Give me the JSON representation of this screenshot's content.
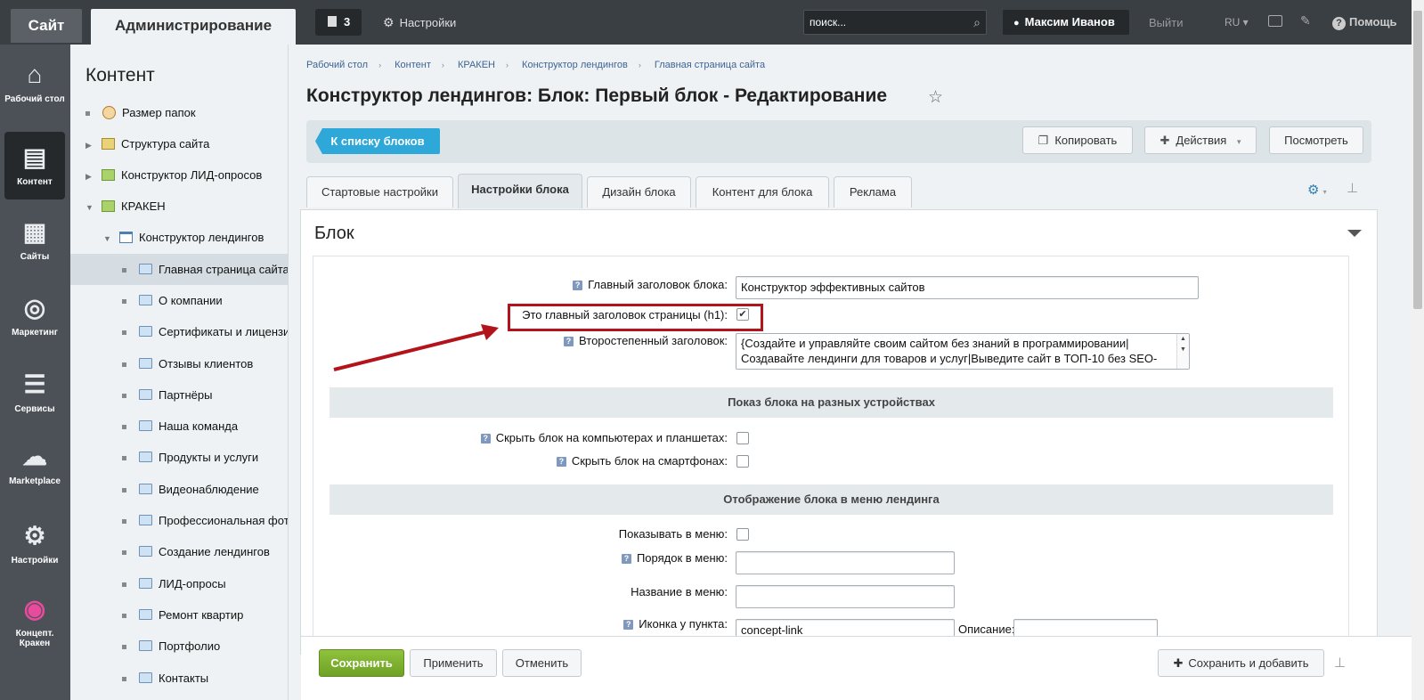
{
  "topbar": {
    "site_tab": "Сайт",
    "admin_tab": "Администрирование",
    "notifications_count": "3",
    "settings_label": "Настройки",
    "search_placeholder": "поиск...",
    "user_name": "Максим Иванов",
    "exit_label": "Выйти",
    "lang_label": "RU",
    "help_label": "Помощь"
  },
  "leftnav": {
    "items": [
      {
        "label": "Рабочий стол",
        "icon": "home-icon"
      },
      {
        "label": "Контент",
        "icon": "document-icon"
      },
      {
        "label": "Сайты",
        "icon": "calendar-icon"
      },
      {
        "label": "Маркетинг",
        "icon": "target-icon"
      },
      {
        "label": "Сервисы",
        "icon": "layers-icon"
      },
      {
        "label": "Marketplace",
        "icon": "cloud-download-icon"
      },
      {
        "label": "Настройки",
        "icon": "gear-icon"
      },
      {
        "label": "Концепт. Кракен",
        "icon": "kraken-logo-icon"
      }
    ]
  },
  "tree": {
    "title": "Контент",
    "items": [
      {
        "label": "Размер папок",
        "icon": "clock-icon"
      },
      {
        "label": "Структура сайта",
        "icon": "structure-icon"
      },
      {
        "label": "Конструктор ЛИД-опросов",
        "icon": "site-icon"
      },
      {
        "label": "КРАКЕН",
        "icon": "site-icon"
      },
      {
        "label": "Конструктор лендингов",
        "icon": "landing-icon"
      },
      {
        "label": "Главная страница сайта",
        "icon": "folder-icon"
      },
      {
        "label": "О компании",
        "icon": "folder-icon"
      },
      {
        "label": "Сертификаты и лицензии",
        "icon": "folder-icon"
      },
      {
        "label": "Отзывы клиентов",
        "icon": "folder-icon"
      },
      {
        "label": "Партнёры",
        "icon": "folder-icon"
      },
      {
        "label": "Наша команда",
        "icon": "folder-icon"
      },
      {
        "label": "Продукты и услуги",
        "icon": "folder-icon"
      },
      {
        "label": "Видеонаблюдение",
        "icon": "folder-icon"
      },
      {
        "label": "Профессиональная фотосъемка",
        "icon": "folder-icon"
      },
      {
        "label": "Создание лендингов",
        "icon": "folder-icon"
      },
      {
        "label": "ЛИД-опросы",
        "icon": "folder-icon"
      },
      {
        "label": "Ремонт квартир",
        "icon": "folder-icon"
      },
      {
        "label": "Портфолио",
        "icon": "folder-icon"
      },
      {
        "label": "Контакты",
        "icon": "folder-icon"
      }
    ]
  },
  "breadcrumbs": [
    "Рабочий стол",
    "Контент",
    "КРАКЕН",
    "Конструктор лендингов",
    "Главная страница сайта"
  ],
  "page_title": "Конструктор лендингов: Блок: Первый блок - Редактирование",
  "actions": {
    "back": "К списку блоков",
    "copy": "Копировать",
    "actions": "Действия",
    "view": "Посмотреть"
  },
  "tabs": [
    "Стартовые настройки",
    "Настройки блока",
    "Дизайн блока",
    "Контент для блока",
    "Реклама"
  ],
  "panel": {
    "title": "Блок",
    "main_heading_label": "Главный заголовок блока:",
    "main_heading_value": "Конструктор эффективных сайтов",
    "h1_label": "Это главный заголовок страницы (h1):",
    "h1_checked": true,
    "secondary_label": "Второстепенный заголовок:",
    "secondary_value": "{Создайте и управляйте своим сайтом без знаний в программировании|Создавайте лендинги для товаров и услуг|Выведите сайт в ТОП-10 без SEO-специалиста|Платформа КРАКЕН для роста вашего бизнеса}",
    "devices_section": "Показ блока на разных устройствах",
    "hide_desktop_label": "Скрыть блок на компьютерах и планшетах:",
    "hide_mobile_label": "Скрыть блок на смартфонах:",
    "menu_section": "Отображение блока в меню лендинга",
    "show_in_menu_label": "Показывать в меню:",
    "menu_order_label": "Порядок в меню:",
    "menu_order_value": "",
    "menu_name_label": "Название в меню:",
    "menu_name_value": "",
    "menu_icon_label": "Иконка у пункта:",
    "menu_icon_value": "concept-link",
    "description_label": "Описание:",
    "description_value": ""
  },
  "bottom": {
    "save": "Сохранить",
    "apply": "Применить",
    "cancel": "Отменить",
    "save_add": "Сохранить и добавить"
  },
  "colors": {
    "annotation_red": "#b3141c",
    "save_green": "#7cb030",
    "back_blue": "#2ea8d8"
  }
}
